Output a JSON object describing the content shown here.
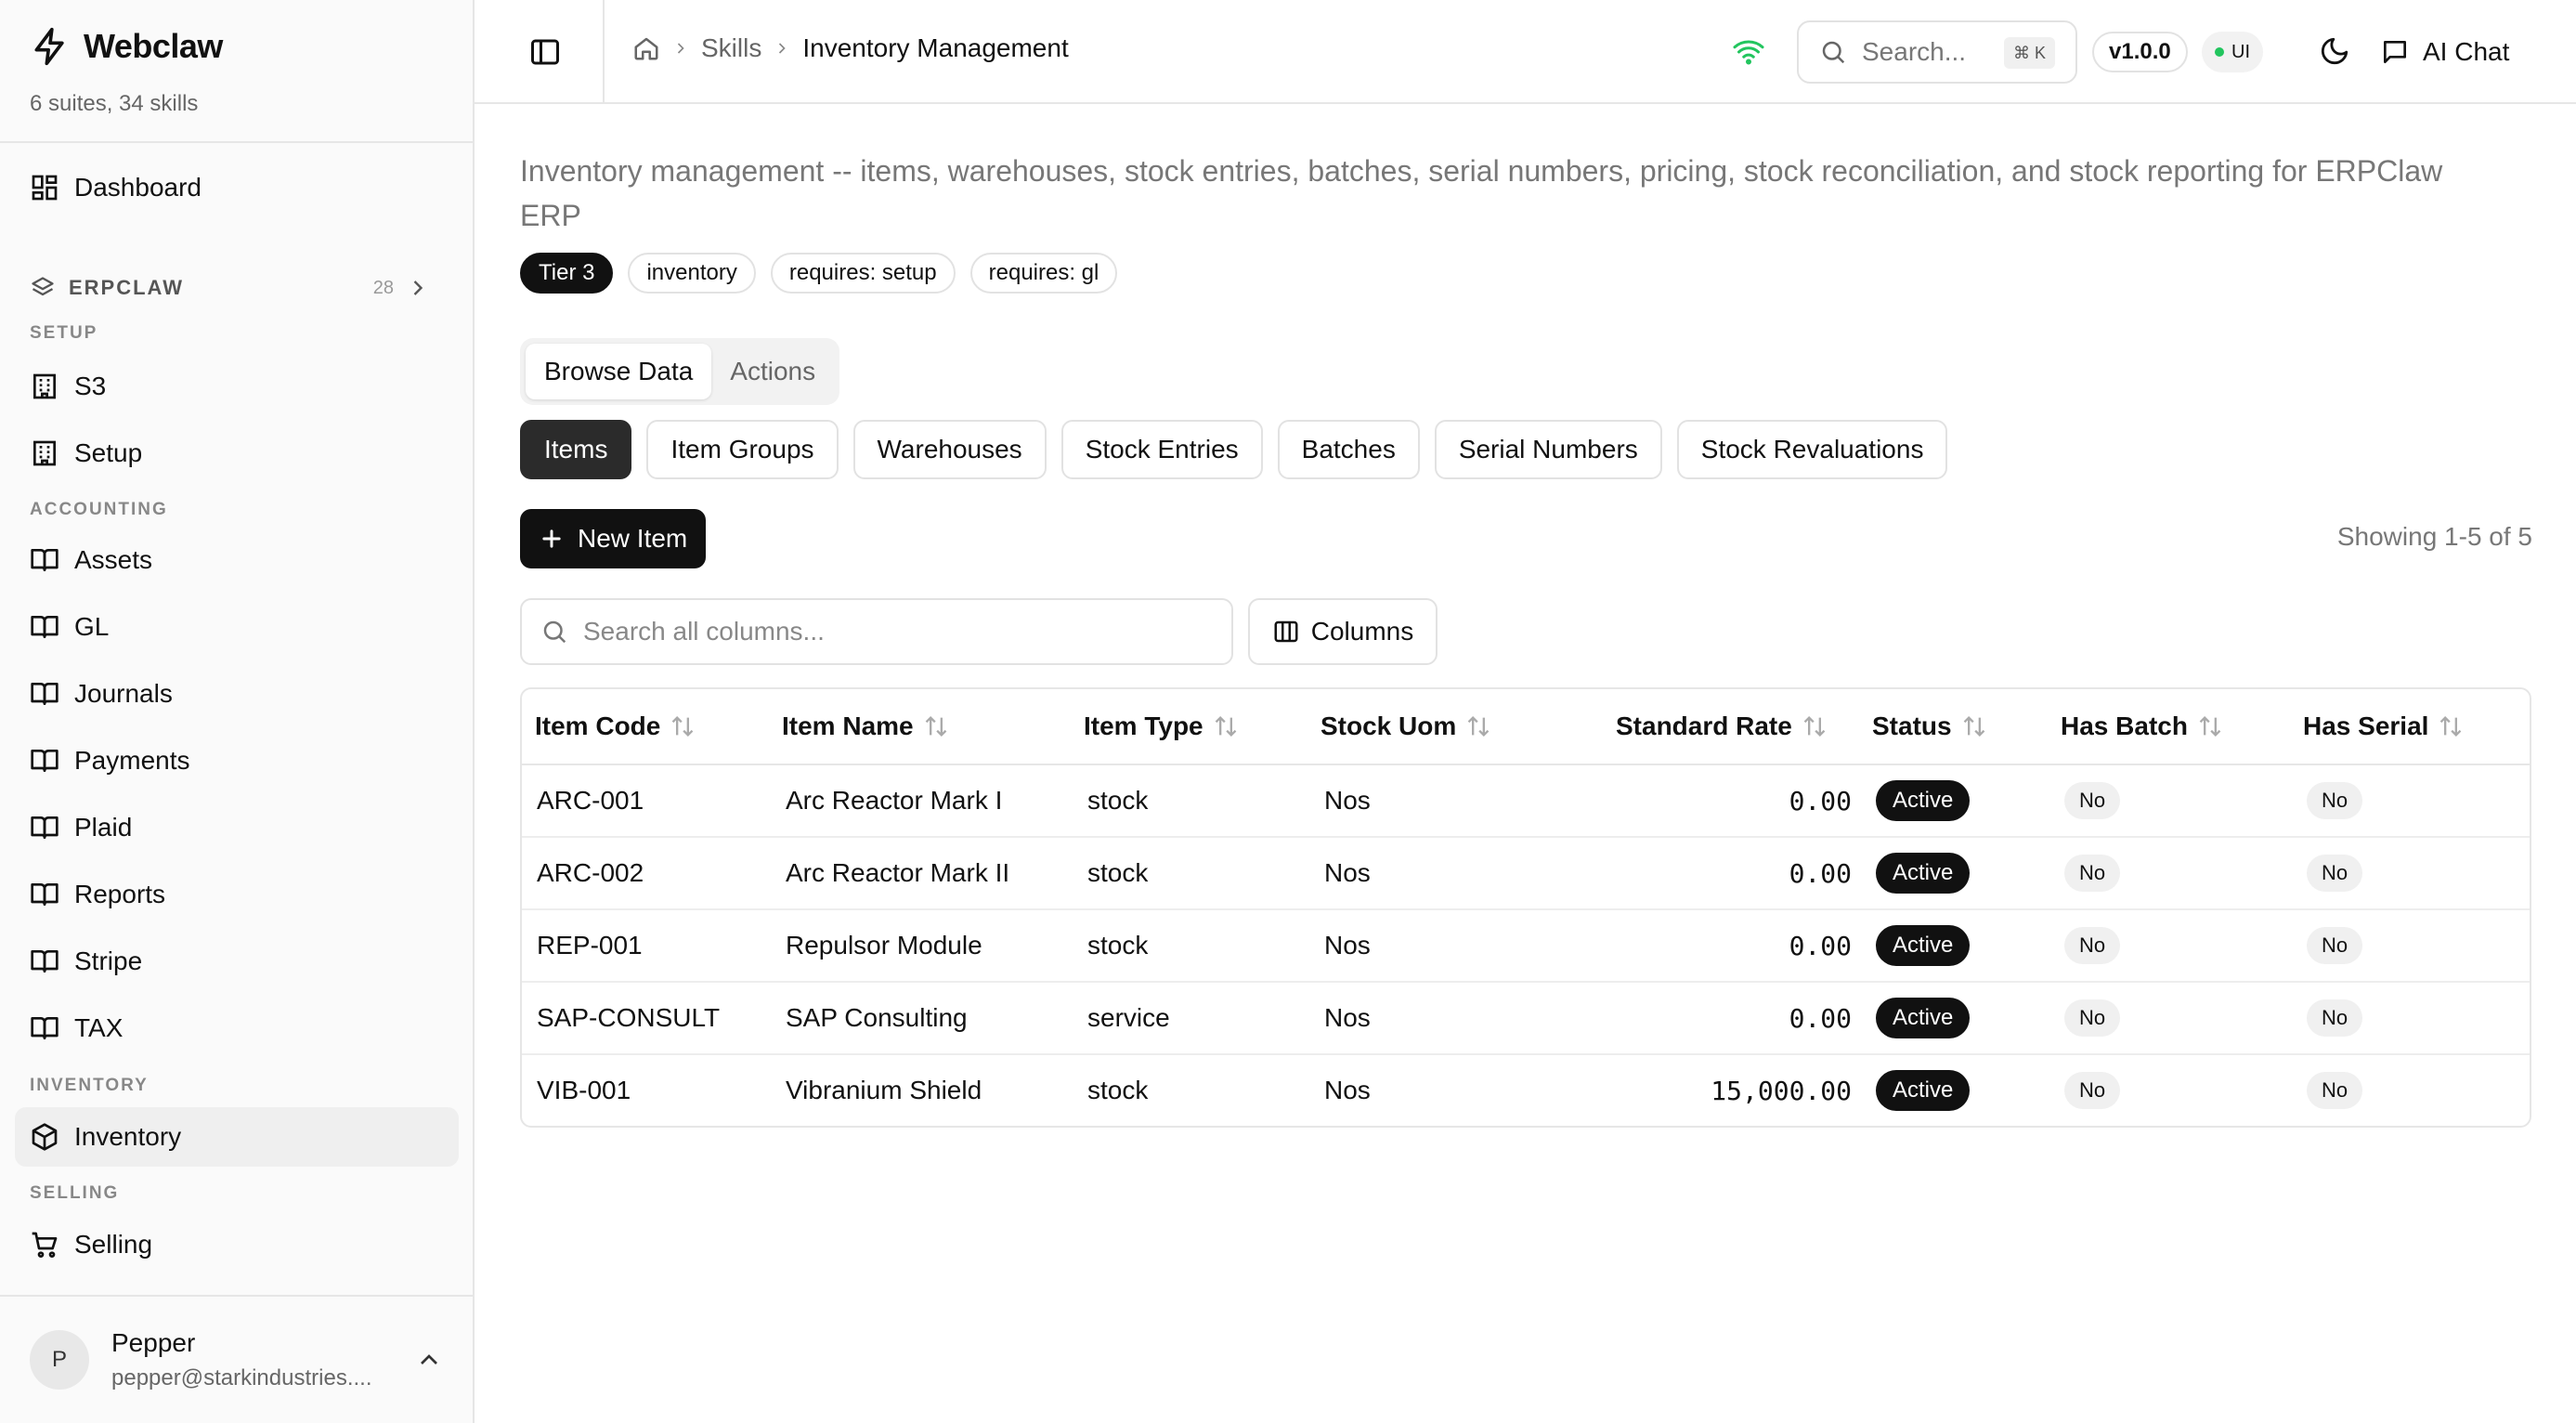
{
  "app": {
    "name": "Webclaw",
    "summary": "6 suites, 34 skills"
  },
  "sidebar": {
    "dashboard_label": "Dashboard",
    "group": {
      "label": "ERPCLAW",
      "count": "28"
    },
    "sections": {
      "setup": "SETUP",
      "accounting": "ACCOUNTING",
      "inventory": "INVENTORY",
      "selling": "SELLING"
    },
    "items": {
      "s3": "S3",
      "setup": "Setup",
      "assets": "Assets",
      "gl": "GL",
      "journals": "Journals",
      "payments": "Payments",
      "plaid": "Plaid",
      "reports": "Reports",
      "stripe": "Stripe",
      "tax": "TAX",
      "inventory": "Inventory",
      "selling": "Selling"
    },
    "user": {
      "initial": "P",
      "name": "Pepper",
      "email": "pepper@starkindustries...."
    }
  },
  "header": {
    "breadcrumb": {
      "skills": "Skills",
      "current": "Inventory Management"
    },
    "search_placeholder": "Search...",
    "search_shortcut": "⌘ K",
    "version": "v1.0.0",
    "ui_label": "UI",
    "ai_chat_label": "AI Chat"
  },
  "page": {
    "description": "Inventory management -- items, warehouses, stock entries, batches, serial numbers, pricing, stock reconciliation, and stock reporting for ERPClaw ERP",
    "tags": [
      "Tier 3",
      "inventory",
      "requires: setup",
      "requires: gl"
    ],
    "modes": {
      "browse": "Browse Data",
      "actions": "Actions"
    },
    "tabs": [
      "Items",
      "Item Groups",
      "Warehouses",
      "Stock Entries",
      "Batches",
      "Serial Numbers",
      "Stock Revaluations"
    ],
    "new_button": "New Item",
    "showing": "Showing 1-5 of 5",
    "column_search_placeholder": "Search all columns...",
    "columns_button": "Columns"
  },
  "table": {
    "headers": {
      "item_code": "Item Code",
      "item_name": "Item Name",
      "item_type": "Item Type",
      "stock_uom": "Stock Uom",
      "standard_rate": "Standard Rate",
      "status": "Status",
      "has_batch": "Has Batch",
      "has_serial": "Has Serial"
    },
    "rows": [
      {
        "item_code": "ARC-001",
        "item_name": "Arc Reactor Mark I",
        "item_type": "stock",
        "stock_uom": "Nos",
        "standard_rate": "0.00",
        "status": "Active",
        "has_batch": "No",
        "has_serial": "No"
      },
      {
        "item_code": "ARC-002",
        "item_name": "Arc Reactor Mark II",
        "item_type": "stock",
        "stock_uom": "Nos",
        "standard_rate": "0.00",
        "status": "Active",
        "has_batch": "No",
        "has_serial": "No"
      },
      {
        "item_code": "REP-001",
        "item_name": "Repulsor Module",
        "item_type": "stock",
        "stock_uom": "Nos",
        "standard_rate": "0.00",
        "status": "Active",
        "has_batch": "No",
        "has_serial": "No"
      },
      {
        "item_code": "SAP-CONSULT",
        "item_name": "SAP Consulting",
        "item_type": "service",
        "stock_uom": "Nos",
        "standard_rate": "0.00",
        "status": "Active",
        "has_batch": "No",
        "has_serial": "No"
      },
      {
        "item_code": "VIB-001",
        "item_name": "Vibranium Shield",
        "item_type": "stock",
        "stock_uom": "Nos",
        "standard_rate": "15,000.00",
        "status": "Active",
        "has_batch": "No",
        "has_serial": "No"
      }
    ]
  },
  "colors": {
    "accent": "#111111",
    "status_dot": "#22c55e",
    "wifi": "#22c55e",
    "sidebar_bg": "#fafafa"
  }
}
